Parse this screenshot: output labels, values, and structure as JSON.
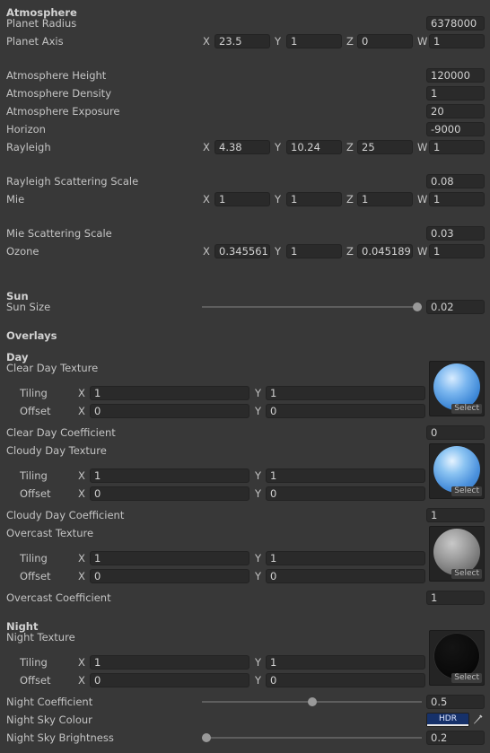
{
  "sections": {
    "atmosphere": "Atmosphere",
    "sun": "Sun",
    "overlays": "Overlays",
    "day": "Day",
    "night": "Night"
  },
  "fields": {
    "planet_radius": {
      "label": "Planet Radius",
      "value": "6378000"
    },
    "planet_axis": {
      "label": "Planet Axis",
      "x": "23.5",
      "y": "1",
      "z": "0",
      "w": "1"
    },
    "atmosphere_height": {
      "label": "Atmosphere Height",
      "value": "120000"
    },
    "atmosphere_density": {
      "label": "Atmosphere Density",
      "value": "1"
    },
    "atmosphere_exposure": {
      "label": "Atmosphere Exposure",
      "value": "20"
    },
    "horizon": {
      "label": "Horizon",
      "value": "-9000"
    },
    "rayleigh": {
      "label": "Rayleigh",
      "x": "4.38",
      "y": "10.24",
      "z": "25",
      "w": "1"
    },
    "rayleigh_scale": {
      "label": "Rayleigh Scattering Scale",
      "value": "0.08"
    },
    "mie": {
      "label": "Mie",
      "x": "1",
      "y": "1",
      "z": "1",
      "w": "1"
    },
    "mie_scale": {
      "label": "Mie Scattering Scale",
      "value": "0.03"
    },
    "ozone": {
      "label": "Ozone",
      "x": "0.345561",
      "y": "1",
      "z": "0.045189",
      "w": "1"
    },
    "sun_size": {
      "label": "Sun Size",
      "value": "0.02",
      "fraction": 1.0
    },
    "clear_day_texture": {
      "label": "Clear Day Texture"
    },
    "clear_day_tiling": {
      "label": "Tiling",
      "x": "1",
      "y": "1"
    },
    "clear_day_offset": {
      "label": "Offset",
      "x": "0",
      "y": "0"
    },
    "clear_day_coefficient": {
      "label": "Clear Day Coefficient",
      "value": "0"
    },
    "cloudy_day_texture": {
      "label": "Cloudy Day Texture"
    },
    "cloudy_day_tiling": {
      "label": "Tiling",
      "x": "1",
      "y": "1"
    },
    "cloudy_day_offset": {
      "label": "Offset",
      "x": "0",
      "y": "0"
    },
    "cloudy_day_coefficient": {
      "label": "Cloudy Day Coefficient",
      "value": "1"
    },
    "overcast_texture": {
      "label": "Overcast Texture"
    },
    "overcast_tiling": {
      "label": "Tiling",
      "x": "1",
      "y": "1"
    },
    "overcast_offset": {
      "label": "Offset",
      "x": "0",
      "y": "0"
    },
    "overcast_coefficient": {
      "label": "Overcast Coefficient",
      "value": "1"
    },
    "night_texture": {
      "label": "Night Texture"
    },
    "night_tiling": {
      "label": "Tiling",
      "x": "1",
      "y": "1"
    },
    "night_offset": {
      "label": "Offset",
      "x": "0",
      "y": "0"
    },
    "night_coefficient": {
      "label": "Night Coefficient",
      "value": "0.5",
      "fraction": 0.5
    },
    "night_sky_colour": {
      "label": "Night Sky Colour",
      "badge": "HDR",
      "color": "#16316a"
    },
    "night_sky_brightness": {
      "label": "Night Sky Brightness",
      "value": "0.2",
      "fraction": 0.0
    }
  },
  "axis_labels": {
    "x": "X",
    "y": "Y",
    "z": "Z",
    "w": "W"
  },
  "texture_select_label": "Select",
  "icons": {
    "eyedropper": "eyedropper-icon"
  }
}
